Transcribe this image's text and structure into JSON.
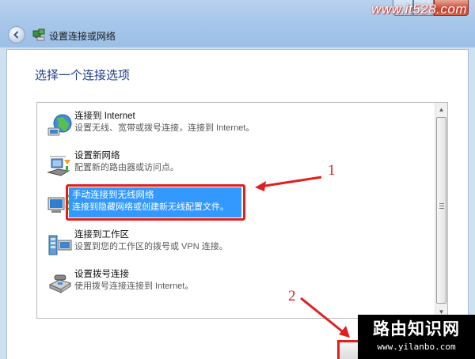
{
  "window": {
    "title": "设置连接或网络",
    "watermark": "www.it528.com"
  },
  "main": {
    "heading": "选择一个连接选项"
  },
  "options": [
    {
      "title": "连接到 Internet",
      "description": "设置无线、宽带或拨号连接，连接到 Internet。",
      "icon": "globe-network-icon",
      "selected": false
    },
    {
      "title": "设置新网络",
      "description": "配置新的路由器或访问点。",
      "icon": "router-icon",
      "selected": false
    },
    {
      "title": "手动连接到无线网络",
      "description": "连接到隐藏网络或创建新无线配置文件。",
      "icon": "wireless-computer-icon",
      "selected": true
    },
    {
      "title": "连接到工作区",
      "description": "设置到您的工作区的拨号或 VPN 连接。",
      "icon": "workplace-icon",
      "selected": false
    },
    {
      "title": "设置拨号连接",
      "description": "使用拨号连接连接到 Internet。",
      "icon": "telephone-modem-icon",
      "selected": false
    }
  ],
  "annotations": {
    "step1": "1",
    "step2": "2"
  },
  "watermark_box": {
    "main": "路由知识网",
    "url": "www.yilanbo.com"
  },
  "colors": {
    "selection": "#3399ff",
    "annotation_red": "#e21f1f",
    "heading": "#1e3f8c"
  }
}
